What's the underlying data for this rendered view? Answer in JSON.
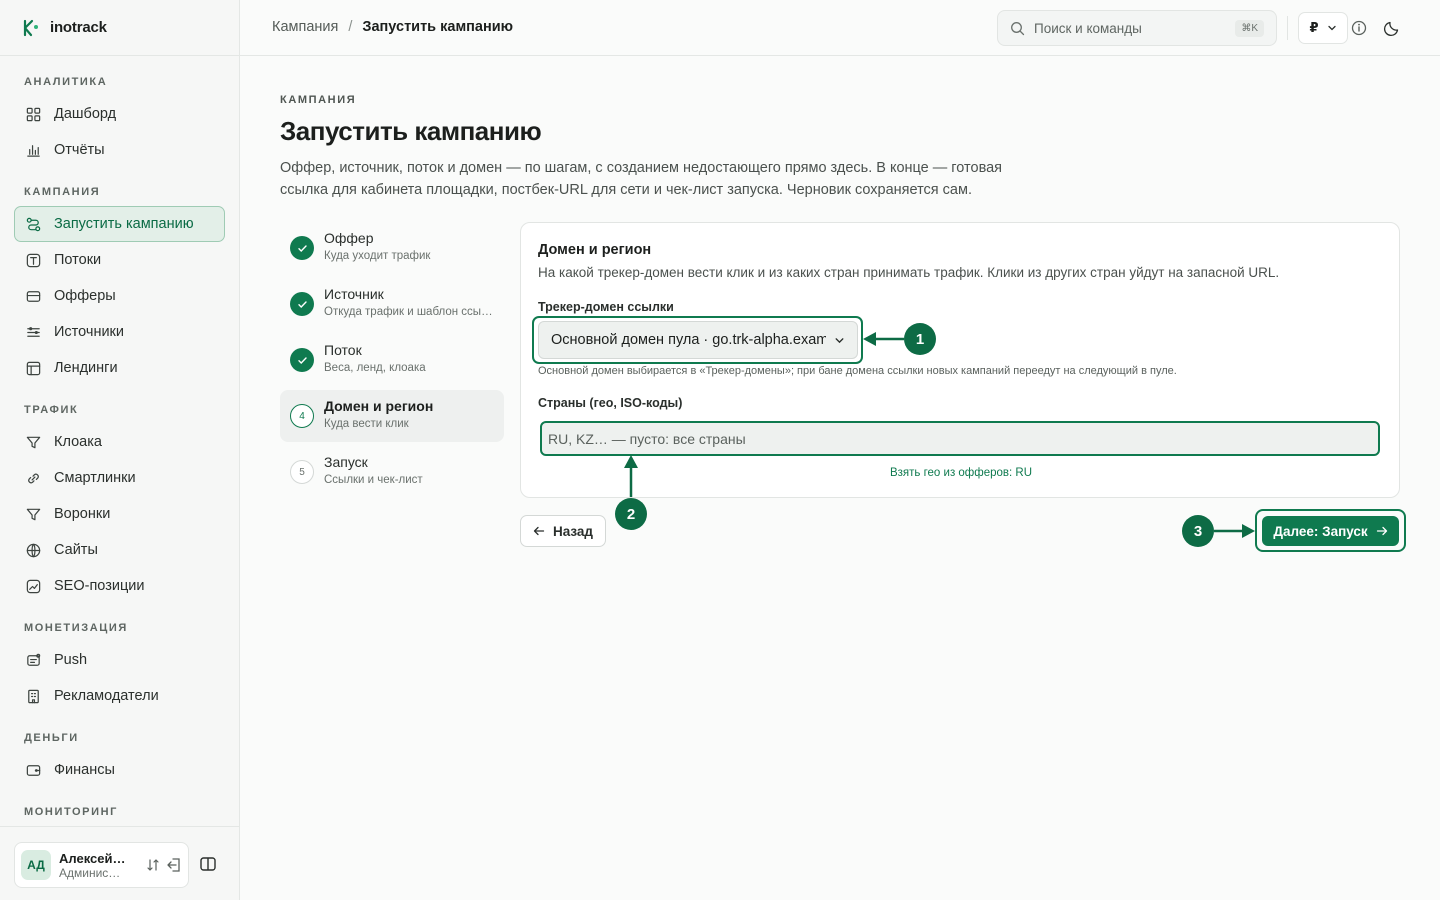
{
  "brand": {
    "name": "inotrack"
  },
  "sidebar": {
    "sections": [
      {
        "title": "АНАЛИТИКА",
        "items": [
          {
            "label": "Дашборд",
            "icon": "dashboard-icon"
          },
          {
            "label": "Отчёты",
            "icon": "chart-icon"
          }
        ]
      },
      {
        "title": "КАМПАНИЯ",
        "items": [
          {
            "label": "Запустить кампанию",
            "icon": "route-icon",
            "active": true
          },
          {
            "label": "Потоки",
            "icon": "flow-icon"
          },
          {
            "label": "Офферы",
            "icon": "offer-icon"
          },
          {
            "label": "Источники",
            "icon": "source-icon"
          },
          {
            "label": "Лендинги",
            "icon": "landing-icon"
          }
        ]
      },
      {
        "title": "ТРАФИК",
        "items": [
          {
            "label": "Клоака",
            "icon": "filter-icon"
          },
          {
            "label": "Смартлинки",
            "icon": "link-icon"
          },
          {
            "label": "Воронки",
            "icon": "funnel-icon"
          },
          {
            "label": "Сайты",
            "icon": "globe-icon"
          },
          {
            "label": "SEO-позиции",
            "icon": "seo-icon"
          }
        ]
      },
      {
        "title": "МОНЕТИЗАЦИЯ",
        "items": [
          {
            "label": "Push",
            "icon": "push-icon"
          },
          {
            "label": "Рекламодатели",
            "icon": "building-icon"
          }
        ]
      },
      {
        "title": "ДЕНЬГИ",
        "items": [
          {
            "label": "Финансы",
            "icon": "wallet-icon"
          }
        ]
      },
      {
        "title": "МОНИТОРИНГ",
        "items": []
      }
    ],
    "user": {
      "initials": "АД",
      "name": "Алексей…",
      "role": "Админис…"
    }
  },
  "header": {
    "breadcrumb": {
      "parent": "Кампания",
      "separator": "/",
      "current": "Запустить кампанию"
    },
    "search": {
      "placeholder": "Поиск и команды",
      "shortcut": "⌘K"
    },
    "currency": "₽"
  },
  "main": {
    "eyebrow": "КАМПАНИЯ",
    "title": "Запустить кампанию",
    "description": "Оффер, источник, поток и домен — по шагам, с созданием недостающего прямо здесь. В конце — готовая ссылка для кабинета площадки, постбек-URL для сети и чек-лист запуска. Черновик сохраняется сам.",
    "steps": [
      {
        "title": "Оффер",
        "subtitle": "Куда уходит трафик",
        "state": "done",
        "number": "1"
      },
      {
        "title": "Источник",
        "subtitle": "Откуда трафик и шаблон ссы…",
        "state": "done",
        "number": "2"
      },
      {
        "title": "Поток",
        "subtitle": "Веса, ленд, клоака",
        "state": "done",
        "number": "3"
      },
      {
        "title": "Домен и регион",
        "subtitle": "Куда вести клик",
        "state": "current",
        "number": "4"
      },
      {
        "title": "Запуск",
        "subtitle": "Ссылки и чек-лист",
        "state": "todo",
        "number": "5"
      }
    ],
    "card": {
      "title": "Домен и регион",
      "description": "На какой трекер-домен вести клик и из каких стран принимать трафик. Клики из других стран уйдут на запасной URL.",
      "domain_label": "Трекер-домен ссылки",
      "domain_value": "Основной домен пула · go.trk-alpha.example",
      "domain_hint": "Основной домен выбирается в «Трекер-домены»; при бане домена ссылки новых кампаний переедут на следующий в пуле.",
      "geo_label": "Страны (гео, ISO-коды)",
      "geo_value": "",
      "geo_placeholder": "RU, KZ… — пусто: все страны",
      "geo_link": "Взять гео из офферов: RU"
    },
    "back_label": "Назад",
    "next_label": "Далее: Запуск"
  },
  "annotations": [
    "1",
    "2",
    "3"
  ],
  "colors": {
    "accent": "#0f7a4f",
    "accent_dark": "#0d6b45",
    "active_bg": "#e3efe8"
  }
}
